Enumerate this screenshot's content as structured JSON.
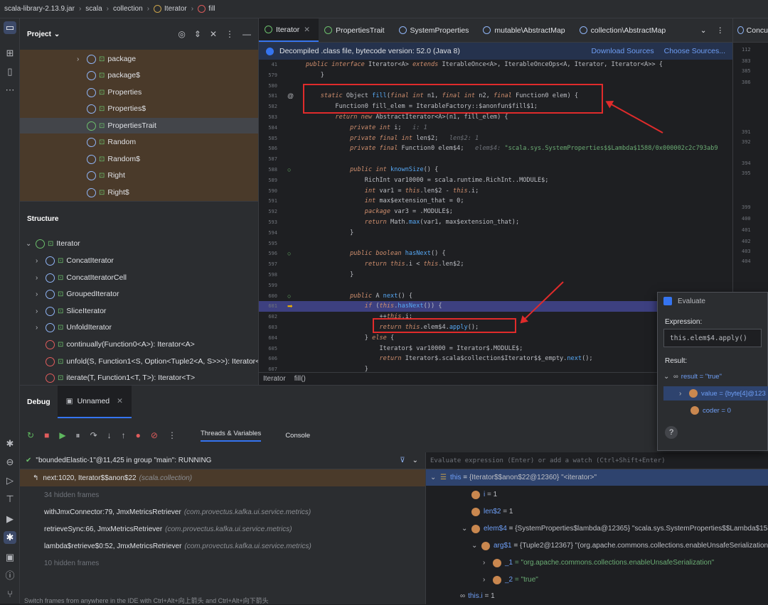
{
  "breadcrumb": [
    "scala-library-2.13.9.jar",
    "scala",
    "collection",
    "Iterator",
    "fill"
  ],
  "project": {
    "title": "Project",
    "items": [
      "package",
      "package$",
      "Properties",
      "Properties$",
      "PropertiesTrait",
      "Random",
      "Random$",
      "Right",
      "Right$"
    ]
  },
  "structure": {
    "title": "Structure",
    "root": "Iterator",
    "items": [
      "ConcatIterator",
      "ConcatIteratorCell",
      "GroupedIterator",
      "SliceIterator",
      "UnfoldIterator",
      "continually(Function0<A>): Iterator<A>",
      "unfold(S, Function1<S, Option<Tuple2<A, S>>>): Iterator<A>",
      "iterate(T, Function1<T, T>): Iterator<T>"
    ]
  },
  "tabs": [
    "Iterator",
    "PropertiesTrait",
    "SystemProperties",
    "mutable\\AbstractMap",
    "collection\\AbstractMap"
  ],
  "right_tab": "Concu",
  "notice": {
    "text": "Decompiled .class file, bytecode version: 52.0 (Java 8)",
    "download": "Download Sources",
    "choose": "Choose Sources..."
  },
  "code_lines": [
    {
      "n": "41",
      "t": "public interface Iterator<A> extends IterableOnce<A>, IterableOnceOps<A, Iterator, Iterator<A>> {"
    },
    {
      "n": "579",
      "t": "    }"
    },
    {
      "n": "580",
      "t": ""
    },
    {
      "n": "581",
      "t": "    static Object fill(final int n1, final int n2, final Function0 elem) {"
    },
    {
      "n": "582",
      "t": "        Function0 fill_elem = IterableFactory::$anonfun$fill$1;"
    },
    {
      "n": "583",
      "t": "        return new AbstractIterator<A>(n1, fill_elem) {"
    },
    {
      "n": "584",
      "t": "            private int i;   i: 1"
    },
    {
      "n": "585",
      "t": "            private final int len$2;   len$2: 1"
    },
    {
      "n": "586",
      "t": "            private final Function0 elem$4;   elem$4: \"scala.sys.SystemProperties$$Lambda$1588/0x000002c2c793ab9"
    },
    {
      "n": "587",
      "t": ""
    },
    {
      "n": "588",
      "t": "            public int knownSize() {"
    },
    {
      "n": "589",
      "t": "                RichInt var10000 = scala.runtime.RichInt..MODULE$;"
    },
    {
      "n": "590",
      "t": "                int var1 = this.len$2 - this.i;"
    },
    {
      "n": "591",
      "t": "                int max$extension_that = 0;"
    },
    {
      "n": "592",
      "t": "                package var3 = .MODULE$;"
    },
    {
      "n": "593",
      "t": "                return Math.max(var1, max$extension_that);"
    },
    {
      "n": "594",
      "t": "            }"
    },
    {
      "n": "595",
      "t": ""
    },
    {
      "n": "596",
      "t": "            public boolean hasNext() {"
    },
    {
      "n": "597",
      "t": "                return this.i < this.len$2;"
    },
    {
      "n": "598",
      "t": "            }"
    },
    {
      "n": "599",
      "t": ""
    },
    {
      "n": "600",
      "t": "            public A next() {"
    },
    {
      "n": "601",
      "t": "                if (this.hasNext()) {"
    },
    {
      "n": "602",
      "t": "                    ++this.i;"
    },
    {
      "n": "603",
      "t": "                    return this.elem$4.apply();"
    },
    {
      "n": "604",
      "t": "                } else {"
    },
    {
      "n": "605",
      "t": "                    Iterator$ var10000 = Iterator$.MODULE$;"
    },
    {
      "n": "606",
      "t": "                    return Iterator$.scala$collection$Iterator$$_empty.next();"
    },
    {
      "n": "607",
      "t": "                }"
    }
  ],
  "right_nums": [
    "112",
    "383",
    "385",
    "386",
    "391",
    "392",
    "394",
    "395",
    "399",
    "400",
    "401",
    "402",
    "403",
    "404"
  ],
  "editor_status": [
    "Iterator",
    "fill()"
  ],
  "debug": {
    "label": "Debug",
    "session": "Unnamed",
    "sub_tabs": [
      "Threads & Variables",
      "Console"
    ]
  },
  "thread": "\"boundedElastic-1\"@11,425 in group \"main\": RUNNING",
  "frames": [
    {
      "m": "next:1020, Iterator$$anon$22",
      "p": "(scala.collection)"
    },
    {
      "m": "34 hidden frames",
      "p": ""
    },
    {
      "m": "withJmxConnector:79, JmxMetricsRetriever",
      "p": "(com.provectus.kafka.ui.service.metrics)"
    },
    {
      "m": "retrieveSync:66, JmxMetricsRetriever",
      "p": "(com.provectus.kafka.ui.service.metrics)"
    },
    {
      "m": "lambda$retrieve$0:52, JmxMetricsRetriever",
      "p": "(com.provectus.kafka.ui.service.metrics)"
    },
    {
      "m": "10 hidden frames",
      "p": ""
    }
  ],
  "tip": "Switch frames from anywhere in the IDE with Ctrl+Alt+向上箭头 and Ctrl+Alt+向下箭头",
  "watch_placeholder": "Evaluate expression (Enter) or add a watch (Ctrl+Shift+Enter)",
  "vars": [
    {
      "name": "this",
      "val": "{Iterator$$anon$22@12360} \"<iterator>\""
    },
    {
      "name": "i",
      "val": "= 1"
    },
    {
      "name": "len$2",
      "val": "= 1"
    },
    {
      "name": "elem$4",
      "val": "{SystemProperties$lambda@12365} \"scala.sys.SystemProperties$$Lambda$1588/0x000"
    },
    {
      "name": "arg$1",
      "val": "{Tuple2@12367} \"(org.apache.commons.collections.enableUnsafeSerialization,true)\""
    },
    {
      "name": "_1",
      "val": "= \"org.apache.commons.collections.enableUnsafeSerialization\""
    },
    {
      "name": "_2",
      "val": "= \"true\""
    },
    {
      "name": "this.i",
      "val": "= 1"
    }
  ],
  "evaluate": {
    "title": "Evaluate",
    "expr_label": "Expression:",
    "expr": "this.elem$4.apply()",
    "result_label": "Result:",
    "r1": "result = \"true\"",
    "r2": "value = {byte[4]@123",
    "r3": "coder = 0",
    "help": "?"
  }
}
